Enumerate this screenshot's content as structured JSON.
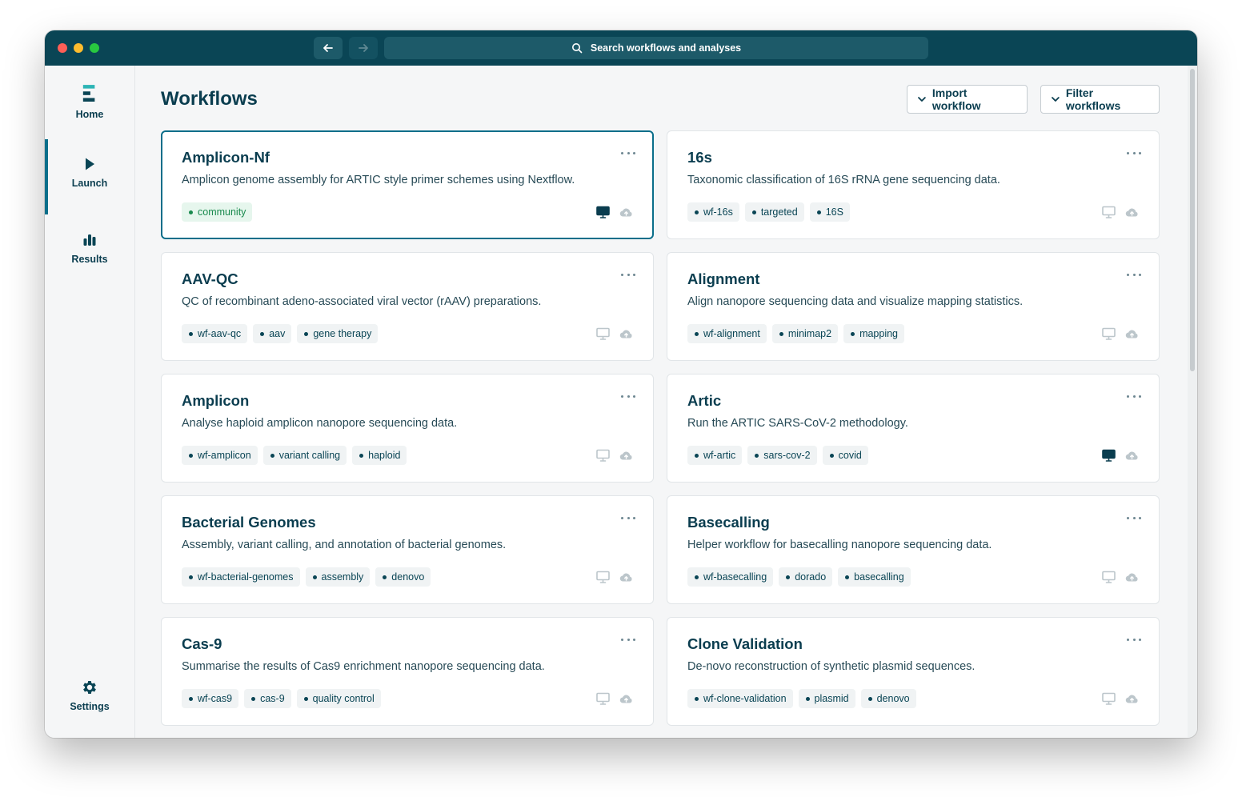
{
  "window": {
    "search_placeholder": "Search workflows and analyses"
  },
  "sidebar": {
    "items": [
      {
        "label": "Home",
        "icon": "logo-icon"
      },
      {
        "label": "Launch",
        "icon": "play-icon",
        "active": true
      },
      {
        "label": "Results",
        "icon": "bar-chart-icon"
      },
      {
        "label": "Settings",
        "icon": "gear-icon"
      }
    ]
  },
  "header": {
    "title": "Workflows",
    "import_label": "Import workflow",
    "filter_label": "Filter workflows"
  },
  "colors": {
    "titlebar": "#0a4555",
    "accent": "#0a6e8a",
    "community_tag": "#1a8a4e"
  },
  "workflows": [
    {
      "title": "Amplicon-Nf",
      "description": "Amplicon genome assembly for ARTIC style primer schemes using Nextflow.",
      "tags": [
        "community"
      ],
      "selected": true,
      "local_available": true
    },
    {
      "title": "16s",
      "description": "Taxonomic classification of 16S rRNA gene sequencing data.",
      "tags": [
        "wf-16s",
        "targeted",
        "16S"
      ],
      "selected": false,
      "local_available": false
    },
    {
      "title": "AAV-QC",
      "description": "QC of recombinant adeno-associated viral vector (rAAV) preparations.",
      "tags": [
        "wf-aav-qc",
        "aav",
        "gene therapy"
      ],
      "selected": false,
      "local_available": false
    },
    {
      "title": "Alignment",
      "description": "Align nanopore sequencing data and visualize mapping statistics.",
      "tags": [
        "wf-alignment",
        "minimap2",
        "mapping"
      ],
      "selected": false,
      "local_available": false
    },
    {
      "title": "Amplicon",
      "description": "Analyse haploid amplicon nanopore sequencing data.",
      "tags": [
        "wf-amplicon",
        "variant calling",
        "haploid"
      ],
      "selected": false,
      "local_available": false
    },
    {
      "title": "Artic",
      "description": "Run the ARTIC SARS-CoV-2 methodology.",
      "tags": [
        "wf-artic",
        "sars-cov-2",
        "covid"
      ],
      "selected": false,
      "local_available": true
    },
    {
      "title": "Bacterial Genomes",
      "description": "Assembly, variant calling, and annotation of bacterial genomes.",
      "tags": [
        "wf-bacterial-genomes",
        "assembly",
        "denovo"
      ],
      "selected": false,
      "local_available": false
    },
    {
      "title": "Basecalling",
      "description": "Helper workflow for basecalling nanopore sequencing data.",
      "tags": [
        "wf-basecalling",
        "dorado",
        "basecalling"
      ],
      "selected": false,
      "local_available": false
    },
    {
      "title": "Cas-9",
      "description": "Summarise the results of Cas9 enrichment nanopore sequencing data.",
      "tags": [
        "wf-cas9",
        "cas-9",
        "quality control"
      ],
      "selected": false,
      "local_available": false
    },
    {
      "title": "Clone Validation",
      "description": "De-novo reconstruction of synthetic plasmid sequences.",
      "tags": [
        "wf-clone-validation",
        "plasmid",
        "denovo"
      ],
      "selected": false,
      "local_available": false
    }
  ]
}
